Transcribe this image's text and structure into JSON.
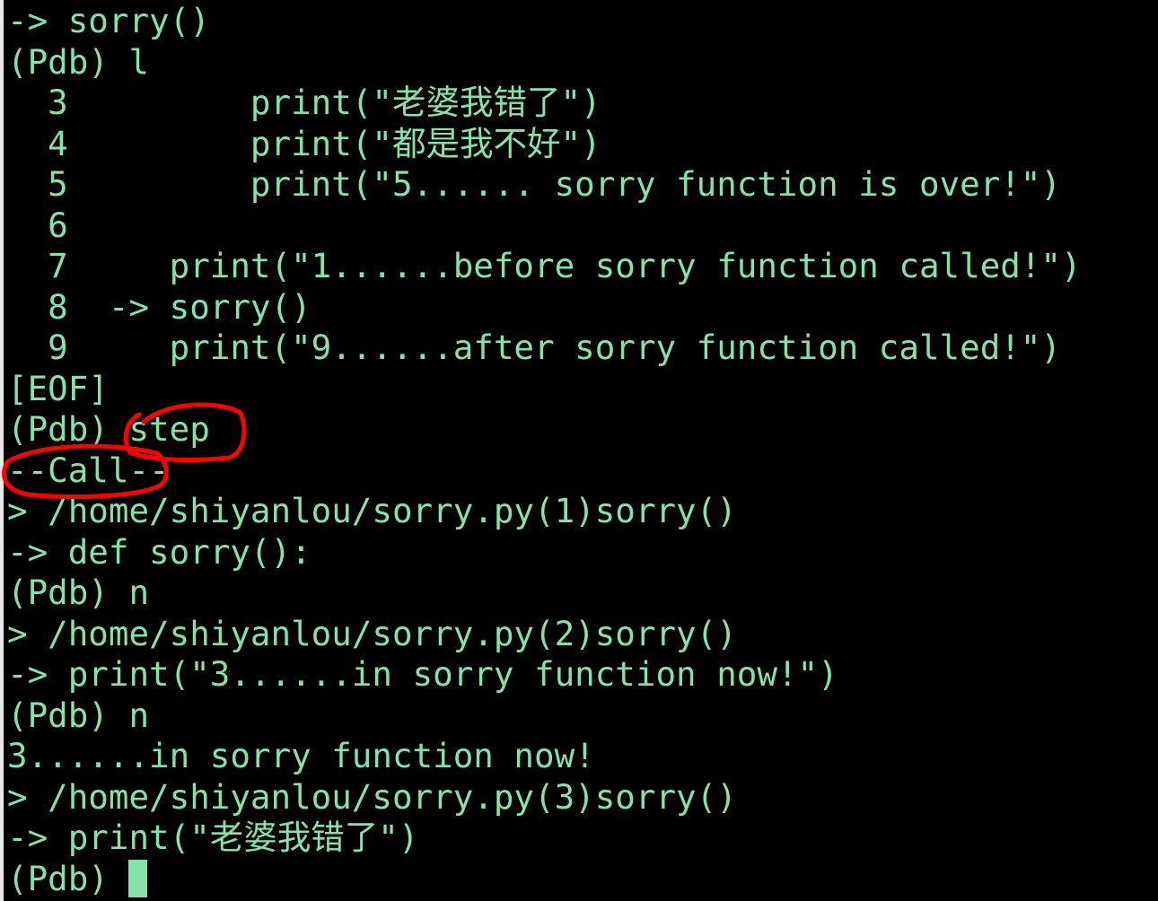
{
  "terminal": {
    "lines": [
      "-> sorry()",
      "(Pdb) l",
      "  3         print(\"老婆我错了\")",
      "  4         print(\"都是我不好\")",
      "  5         print(\"5...... sorry function is over!\")",
      "  6",
      "  7     print(\"1......before sorry function called!\")",
      "  8  -> sorry()",
      "  9     print(\"9......after sorry function called!\")",
      "[EOF]",
      "(Pdb) step",
      "--Call--",
      "> /home/shiyanlou/sorry.py(1)sorry()",
      "-> def sorry():",
      "(Pdb) n",
      "> /home/shiyanlou/sorry.py(2)sorry()",
      "-> print(\"3......in sorry function now!\")",
      "(Pdb) n",
      "3......in sorry function now!",
      "> /home/shiyanlou/sorry.py(3)sorry()",
      "-> print(\"老婆我错了\")"
    ],
    "prompt": "(Pdb) "
  },
  "colors": {
    "text": "#84e3a6",
    "background": "#000000",
    "annotation": "#ff0000"
  }
}
